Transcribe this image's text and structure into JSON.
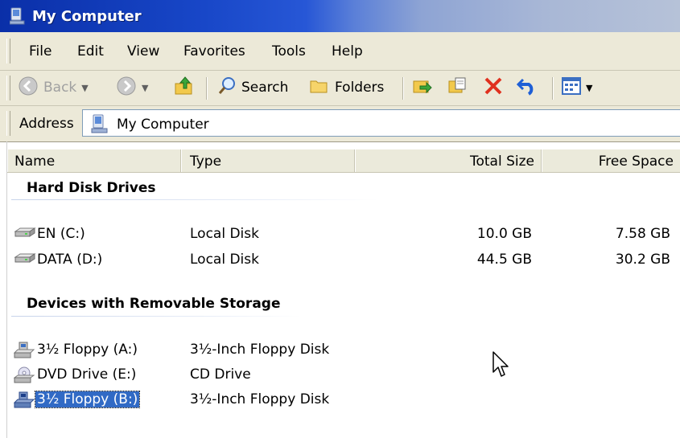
{
  "window": {
    "title": "My Computer"
  },
  "menu": {
    "items": [
      "File",
      "Edit",
      "View",
      "Favorites",
      "Tools",
      "Help"
    ]
  },
  "toolbar": {
    "back_label": "Back",
    "search_label": "Search",
    "folders_label": "Folders"
  },
  "address": {
    "label": "Address",
    "value": "My Computer"
  },
  "columns": {
    "name": "Name",
    "type": "Type",
    "total": "Total Size",
    "free": "Free Space"
  },
  "groups": {
    "hard_disks": {
      "title": "Hard Disk Drives",
      "items": [
        {
          "name": "EN (C:)",
          "type": "Local Disk",
          "total": "10.0 GB",
          "free": "7.58 GB"
        },
        {
          "name": "DATA (D:)",
          "type": "Local Disk",
          "total": "44.5 GB",
          "free": "30.2 GB"
        }
      ]
    },
    "removable": {
      "title": "Devices with Removable Storage",
      "items": [
        {
          "name": "3½ Floppy (A:)",
          "type": "3½-Inch Floppy Disk"
        },
        {
          "name": "DVD Drive (E:)",
          "type": "CD Drive"
        },
        {
          "name": "3½ Floppy (B:)",
          "type": "3½-Inch Floppy Disk",
          "selected": true
        }
      ]
    }
  },
  "colors": {
    "selection": "#316ac5",
    "titlebar": "#1847c8",
    "chrome": "#ece9d8"
  }
}
